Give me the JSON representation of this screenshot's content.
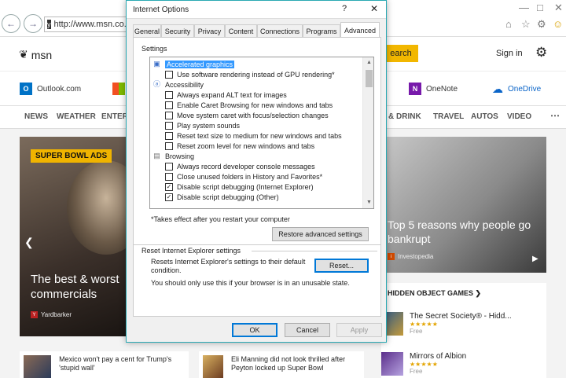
{
  "browser": {
    "address": "http://www.msn.co...",
    "favicon": "y"
  },
  "msn": {
    "logo": "msn",
    "search_button": "earch",
    "sign_in": "Sign in",
    "apps": [
      "Outlook.com",
      "OneNote",
      "OneDrive"
    ],
    "categories": [
      "NEWS",
      "WEATHER",
      "ENTER",
      "& DRINK",
      "TRAVEL",
      "AUTOS",
      "VIDEO"
    ],
    "hero": {
      "badge": "SUPER BOWL ADS",
      "title": "The best & worst commercials",
      "source": "Yardbarker"
    },
    "story2": {
      "title": "Top 5 reasons why people go bankrupt",
      "source": "Investopedia"
    },
    "games": {
      "header": "HIDDEN OBJECT GAMES",
      "items": [
        {
          "name": "The Secret Society® - Hidd...",
          "stars": "★★★★★",
          "price": "Free"
        },
        {
          "name": "Mirrors of Albion",
          "stars": "★★★★★",
          "price": "Free"
        }
      ]
    },
    "news": [
      {
        "text": "Mexico won't pay a cent for Trump's 'stupid wall'"
      },
      {
        "text": "Eli Manning did not look thrilled after Peyton locked up Super Bowl"
      }
    ]
  },
  "dialog": {
    "title": "Internet Options",
    "help": "?",
    "tabs": [
      "General",
      "Security",
      "Privacy",
      "Content",
      "Connections",
      "Programs",
      "Advanced"
    ],
    "settings_label": "Settings",
    "tree": [
      {
        "type": "group",
        "label": "Accelerated graphics",
        "selected": true
      },
      {
        "type": "check",
        "label": "Use software rendering instead of GPU rendering*",
        "checked": false
      },
      {
        "type": "group",
        "label": "Accessibility"
      },
      {
        "type": "check",
        "label": "Always expand ALT text for images",
        "checked": false
      },
      {
        "type": "check",
        "label": "Enable Caret Browsing for new windows and tabs",
        "checked": false
      },
      {
        "type": "check",
        "label": "Move system caret with focus/selection changes",
        "checked": false
      },
      {
        "type": "check",
        "label": "Play system sounds",
        "checked": false
      },
      {
        "type": "check",
        "label": "Reset text size to medium for new windows and tabs",
        "checked": false
      },
      {
        "type": "check",
        "label": "Reset zoom level for new windows and tabs",
        "checked": false
      },
      {
        "type": "group",
        "label": "Browsing"
      },
      {
        "type": "check",
        "label": "Always record developer console messages",
        "checked": false
      },
      {
        "type": "check",
        "label": "Close unused folders in History and Favorites*",
        "checked": false
      },
      {
        "type": "check",
        "label": "Disable script debugging (Internet Explorer)",
        "checked": true
      },
      {
        "type": "check",
        "label": "Disable script debugging (Other)",
        "checked": true
      }
    ],
    "restart_note": "*Takes effect after you restart your computer",
    "restore_button": "Restore advanced settings",
    "reset_header": "Reset Internet Explorer settings",
    "reset_desc": "Resets Internet Explorer's settings to their default condition.",
    "reset_button": "Reset...",
    "reset_warning": "You should only use this if your browser is in an unusable state.",
    "ok": "OK",
    "cancel": "Cancel",
    "apply": "Apply"
  }
}
